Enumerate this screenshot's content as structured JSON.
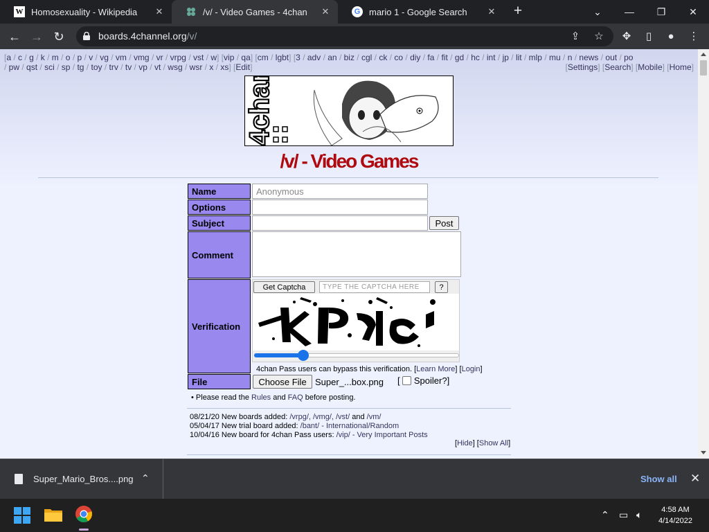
{
  "browser": {
    "tabs": [
      {
        "title": "Homosexuality - Wikipedia",
        "favicon": "W"
      },
      {
        "title": "/v/ - Video Games - 4chan",
        "favicon": "clover"
      },
      {
        "title": "mario 1 - Google Search",
        "favicon": "G"
      }
    ],
    "url_host": "boards.4channel.org",
    "url_path": "/v/"
  },
  "page": {
    "boards_row1": [
      "a",
      "c",
      "g",
      "k",
      "m",
      "o",
      "p",
      "v",
      "vg",
      "vm",
      "vmg",
      "vr",
      "vrpg",
      "vst",
      "w"
    ],
    "boards_row1_b": [
      "vip",
      "qa"
    ],
    "boards_row1_c": [
      "cm",
      "lgbt"
    ],
    "boards_row1_d": [
      "3",
      "adv",
      "an",
      "biz",
      "cgl",
      "ck",
      "co",
      "diy",
      "fa",
      "fit",
      "gd",
      "hc",
      "int",
      "jp",
      "lit",
      "mlp",
      "mu",
      "n",
      "news",
      "out",
      "po"
    ],
    "boards_row2": [
      "pw",
      "qst",
      "sci",
      "sp",
      "tg",
      "toy",
      "trv",
      "tv",
      "vp",
      "vt",
      "wsg",
      "wsr",
      "x",
      "xs"
    ],
    "edit_label": "Edit",
    "nav_right": [
      "Settings",
      "Search",
      "Mobile",
      "Home"
    ],
    "board_title": "/v/ - Video Games",
    "banner_logo": "4chan",
    "form": {
      "name_label": "Name",
      "name_placeholder": "Anonymous",
      "options_label": "Options",
      "subject_label": "Subject",
      "post_button": "Post",
      "comment_label": "Comment",
      "verification_label": "Verification",
      "get_captcha": "Get Captcha",
      "captcha_placeholder": "TYPE THE CAPTCHA HERE",
      "captcha_help": "?",
      "captcha_slider_level": 0.24,
      "pass_note": "4chan Pass users can bypass this verification.",
      "learn_more": "Learn More",
      "login": "Login",
      "file_label": "File",
      "choose_file": "Choose File",
      "file_name": "Super_...box.png",
      "spoiler_label": "Spoiler?"
    },
    "rules_prefix": "• Please read the",
    "rules_link": "Rules",
    "and_text": "and",
    "faq_link": "FAQ",
    "rules_suffix": "before posting.",
    "news": [
      {
        "date": "08/21/20",
        "text": "New boards added:",
        "links": "/vrpg/, /vmg/, /vst/",
        "and": "and",
        "last": "/vm/"
      },
      {
        "date": "05/04/17",
        "text": "New trial board added:",
        "links": "/bant/ - International/Random"
      },
      {
        "date": "10/04/16",
        "text": "New board for 4chan Pass users:",
        "links": "/vip/ - Very Important Posts"
      }
    ],
    "hide_label": "Hide",
    "show_all_label": "Show All"
  },
  "downloads": {
    "file": "Super_Mario_Bros....png",
    "show_all": "Show all"
  },
  "taskbar": {
    "time": "4:58 AM",
    "date": "4/14/2022"
  }
}
